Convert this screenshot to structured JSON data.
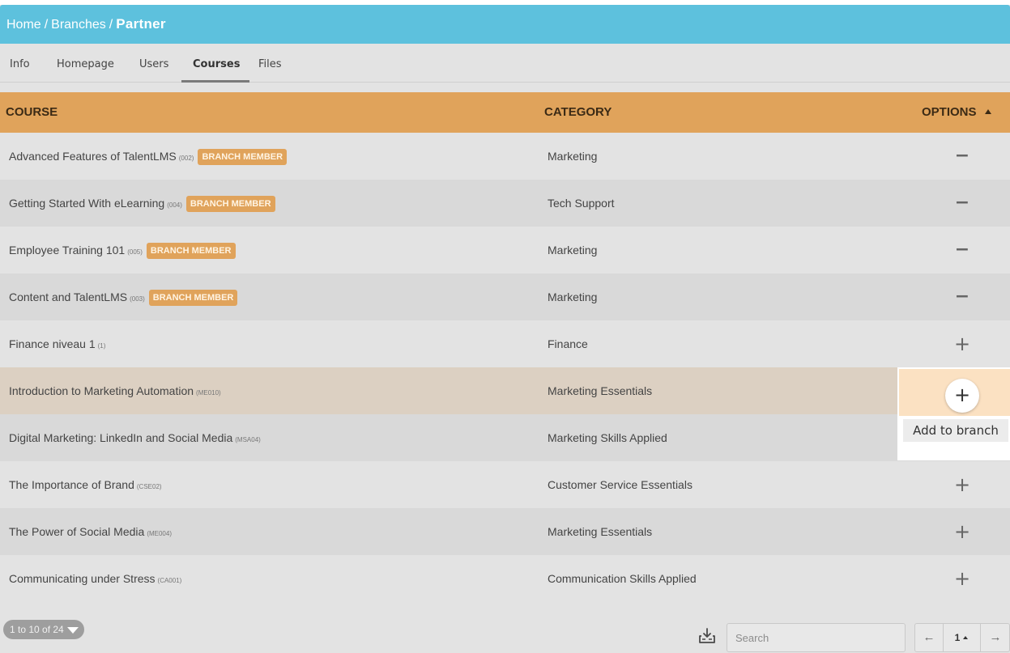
{
  "breadcrumb": {
    "home": "Home",
    "sep1": "/",
    "branches": "Branches",
    "sep2": "/",
    "current": "Partner"
  },
  "tabs": [
    {
      "label": "Info",
      "active": false
    },
    {
      "label": "Homepage",
      "active": false
    },
    {
      "label": "Users",
      "active": false
    },
    {
      "label": "Courses",
      "active": true
    },
    {
      "label": "Files",
      "active": false
    }
  ],
  "table": {
    "headers": {
      "course": "COURSE",
      "category": "CATEGORY",
      "options": "OPTIONS"
    },
    "sort": "ascending",
    "rows": [
      {
        "name": "Advanced Features of TalentLMS",
        "code": "(002)",
        "badge": "BRANCH MEMBER",
        "category": "Marketing",
        "option": "−"
      },
      {
        "name": "Getting Started With eLearning",
        "code": "(004)",
        "badge": "BRANCH MEMBER",
        "category": "Tech Support",
        "option": "−"
      },
      {
        "name": "Employee Training 101",
        "code": "(005)",
        "badge": "BRANCH MEMBER",
        "category": "Marketing",
        "option": "−"
      },
      {
        "name": "Content and TalentLMS",
        "code": "(003)",
        "badge": "BRANCH MEMBER",
        "category": "Marketing",
        "option": "−"
      },
      {
        "name": "Finance niveau 1",
        "code": "(1)",
        "badge": "",
        "category": "Finance",
        "option": "+"
      },
      {
        "name": "Introduction to Marketing Automation",
        "code": "(ME010)",
        "badge": "",
        "category": "Marketing Essentials",
        "option": "+"
      },
      {
        "name": "Digital Marketing: LinkedIn and Social Media",
        "code": "(MSA04)",
        "badge": "",
        "category": "Marketing Skills Applied",
        "option": "+"
      },
      {
        "name": "The Importance of Brand",
        "code": "(CSE02)",
        "badge": "",
        "category": "Customer Service Essentials",
        "option": "+"
      },
      {
        "name": "The Power of Social Media",
        "code": "(ME004)",
        "badge": "",
        "category": "Marketing Essentials",
        "option": "+"
      },
      {
        "name": "Communicating under Stress",
        "code": "(CA001)",
        "badge": "",
        "category": "Communication Skills Applied",
        "option": "+"
      }
    ]
  },
  "hover": {
    "tooltip": "Add to branch",
    "button_symbol": "+"
  },
  "footer": {
    "pager_info": "1 to 10 of 24",
    "search_placeholder": "Search",
    "prev_symbol": "←",
    "page": "1",
    "next_symbol": "→"
  },
  "icons": {
    "export": "download-export-icon",
    "sort": "caret-up-icon",
    "pager_dropdown": "caret-down-icon"
  },
  "colors": {
    "header_bar": "#5dc1dd",
    "table_header": "#e0a35b",
    "badge": "#e0a35b",
    "hover_row": "#dcd0c2",
    "hover_cell": "#fbe1c2"
  }
}
